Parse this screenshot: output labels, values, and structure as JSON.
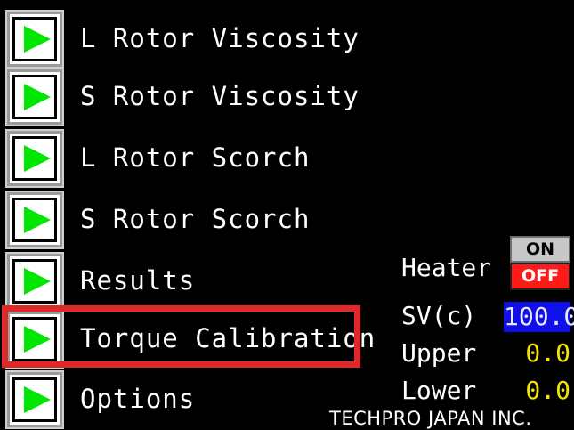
{
  "menu": {
    "items": [
      {
        "label": "L Rotor Viscosity",
        "icon": "play-icon"
      },
      {
        "label": "S Rotor Viscosity",
        "icon": "play-icon"
      },
      {
        "label": "L Rotor Scorch",
        "icon": "play-icon"
      },
      {
        "label": "S Rotor Scorch",
        "icon": "play-icon"
      },
      {
        "label": "Results",
        "icon": "play-icon"
      },
      {
        "label": "Torque Calibration",
        "icon": "play-icon",
        "highlighted": true
      },
      {
        "label": "Options",
        "icon": "play-icon"
      }
    ]
  },
  "status": {
    "heater_label": "Heater",
    "heater_on_label": "ON",
    "heater_off_label": "OFF",
    "heater_state": "OFF",
    "sv_label": "SV(c)",
    "sv_value": "100.0",
    "upper_label": "Upper",
    "upper_value": "0.0",
    "lower_label": "Lower",
    "lower_value": "0.0"
  },
  "footer": {
    "company": "TECHPRO JAPAN INC."
  },
  "colors": {
    "background": "#000000",
    "play_icon": "#00e600",
    "highlight": "#e0282a",
    "sv_bg": "#1010e8",
    "value_text": "#f2e600",
    "off_button": "#ff1a1a"
  }
}
